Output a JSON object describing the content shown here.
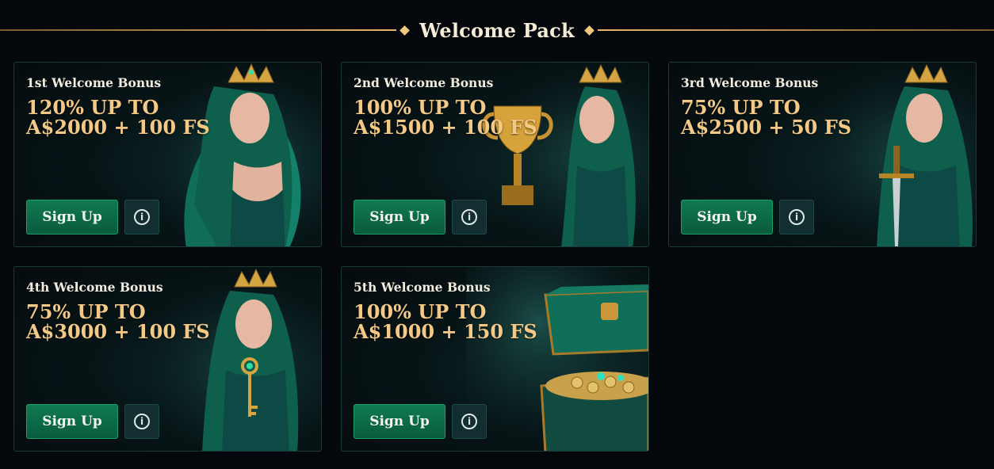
{
  "header": {
    "title": "Welcome Pack"
  },
  "cards": [
    {
      "label": "1st Welcome Bonus",
      "offer": "120% UP TO A$2000 + 100 FS",
      "cta": "Sign Up",
      "art": "elf-queen-image"
    },
    {
      "label": "2nd Welcome Bonus",
      "offer": "100% UP TO A$1500 + 100 FS",
      "cta": "Sign Up",
      "art": "elf-queen-trophy-image"
    },
    {
      "label": "3rd Welcome Bonus",
      "offer": "75% UP TO A$2500 + 50 FS",
      "cta": "Sign Up",
      "art": "elf-queen-sword-image"
    },
    {
      "label": "4th Welcome Bonus",
      "offer": "75% UP TO A$3000 + 100 FS",
      "cta": "Sign Up",
      "art": "elf-queen-key-image"
    },
    {
      "label": "5th Welcome Bonus",
      "offer": "100% UP TO A$1000 + 150 FS",
      "cta": "Sign Up",
      "art": "treasure-chest-image"
    }
  ],
  "colors": {
    "background": "#04070b",
    "accent_gold": "#f4c986",
    "button_green": "#0f7a52",
    "info_button": "#122e31"
  },
  "icons": {
    "info": "info-icon",
    "divider": "diamond-icon"
  }
}
